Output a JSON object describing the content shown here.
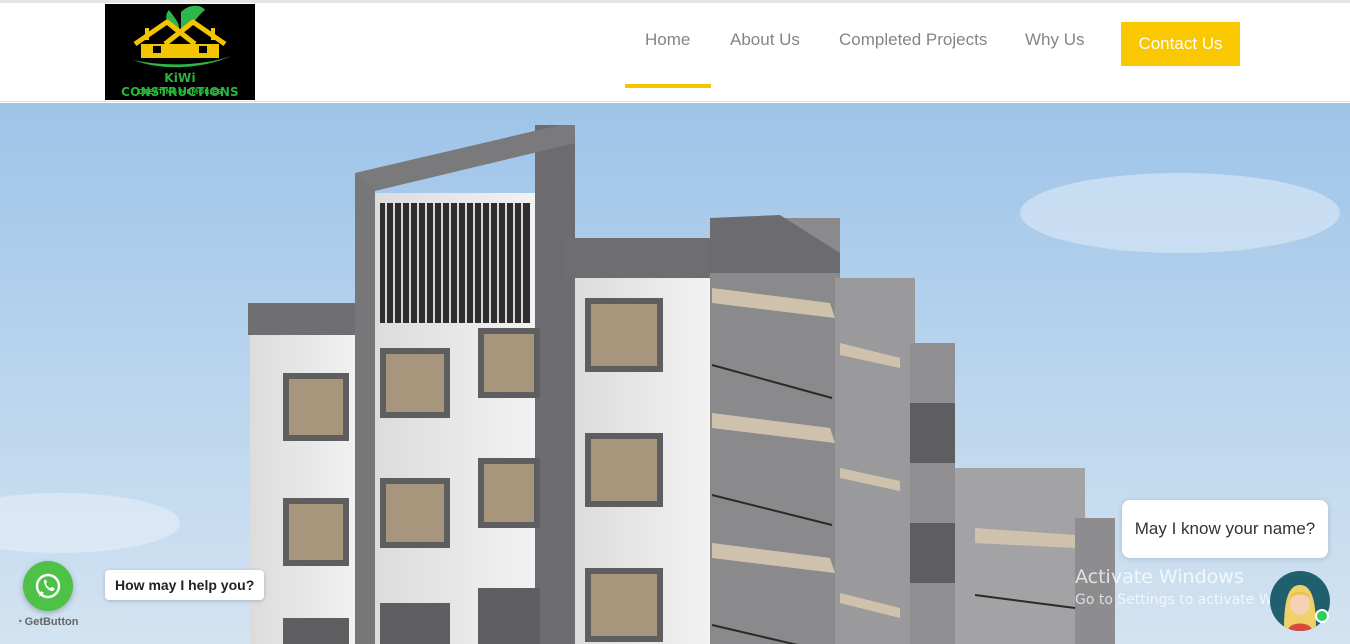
{
  "logo": {
    "name": "KiWi  CONSTRUCTIONS",
    "tagline": "CREATING MEMORIES",
    "icon": "house-with-leaf-logo"
  },
  "nav": {
    "items": [
      "Home",
      "About Us",
      "Completed Projects",
      "Why Us"
    ],
    "active": "Home",
    "contact_label": "Contact Us"
  },
  "colors": {
    "accent": "#f9c800",
    "whatsapp": "#4dc247",
    "online": "#2bd05b"
  },
  "hero": {
    "image": "apartment-building-render"
  },
  "whatsapp_widget": {
    "icon": "whatsapp-icon",
    "prompt": "How may I help you?",
    "branding": "GetButton"
  },
  "chat_widget": {
    "message": "May I know your name?",
    "avatar": "agent-avatar"
  },
  "watermark": {
    "title": "Activate Windows",
    "subtitle": "Go to Settings to activate Windows."
  }
}
